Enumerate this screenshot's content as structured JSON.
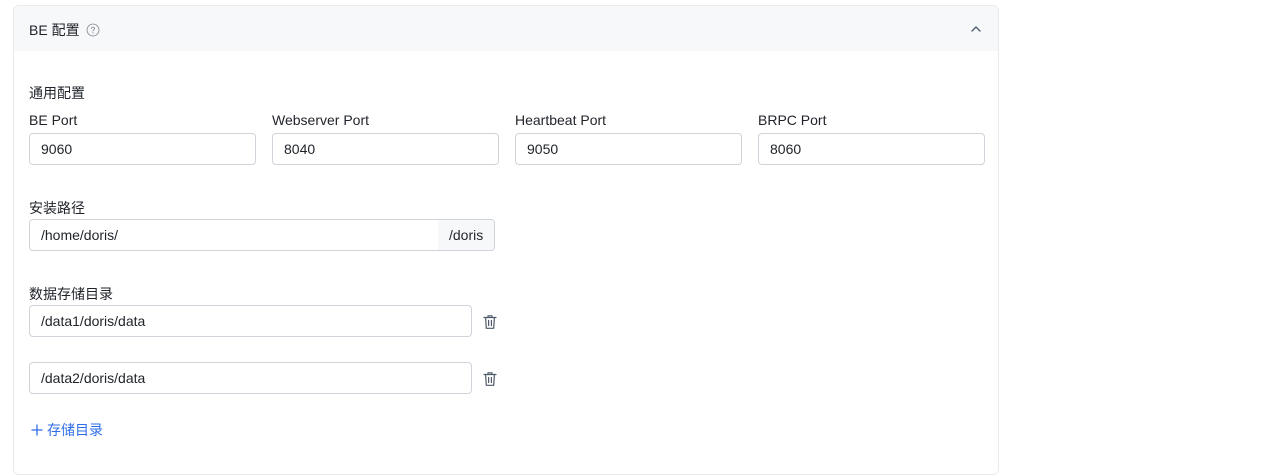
{
  "panel": {
    "title": "BE 配置",
    "help_icon": "question-circle-icon",
    "collapse_icon": "chevron-up-icon"
  },
  "general": {
    "section_title": "通用配置",
    "fields": [
      {
        "label": "BE Port",
        "value": "9060"
      },
      {
        "label": "Webserver Port",
        "value": "8040"
      },
      {
        "label": "Heartbeat Port",
        "value": "9050"
      },
      {
        "label": "BRPC Port",
        "value": "8060"
      }
    ]
  },
  "install_path": {
    "label": "安装路径",
    "value": "/home/doris/",
    "suffix": "/doris"
  },
  "data_dirs": {
    "label": "数据存储目录",
    "items": [
      {
        "value": "/data1/doris/data",
        "delete_icon": "trash-icon"
      },
      {
        "value": "/data2/doris/data",
        "delete_icon": "trash-icon"
      }
    ],
    "add_label": "存储目录",
    "add_icon": "plus-icon"
  },
  "colors": {
    "accent": "#2f6ee8",
    "header_bg": "#f7f8fa",
    "border": "#d0d3d9"
  }
}
